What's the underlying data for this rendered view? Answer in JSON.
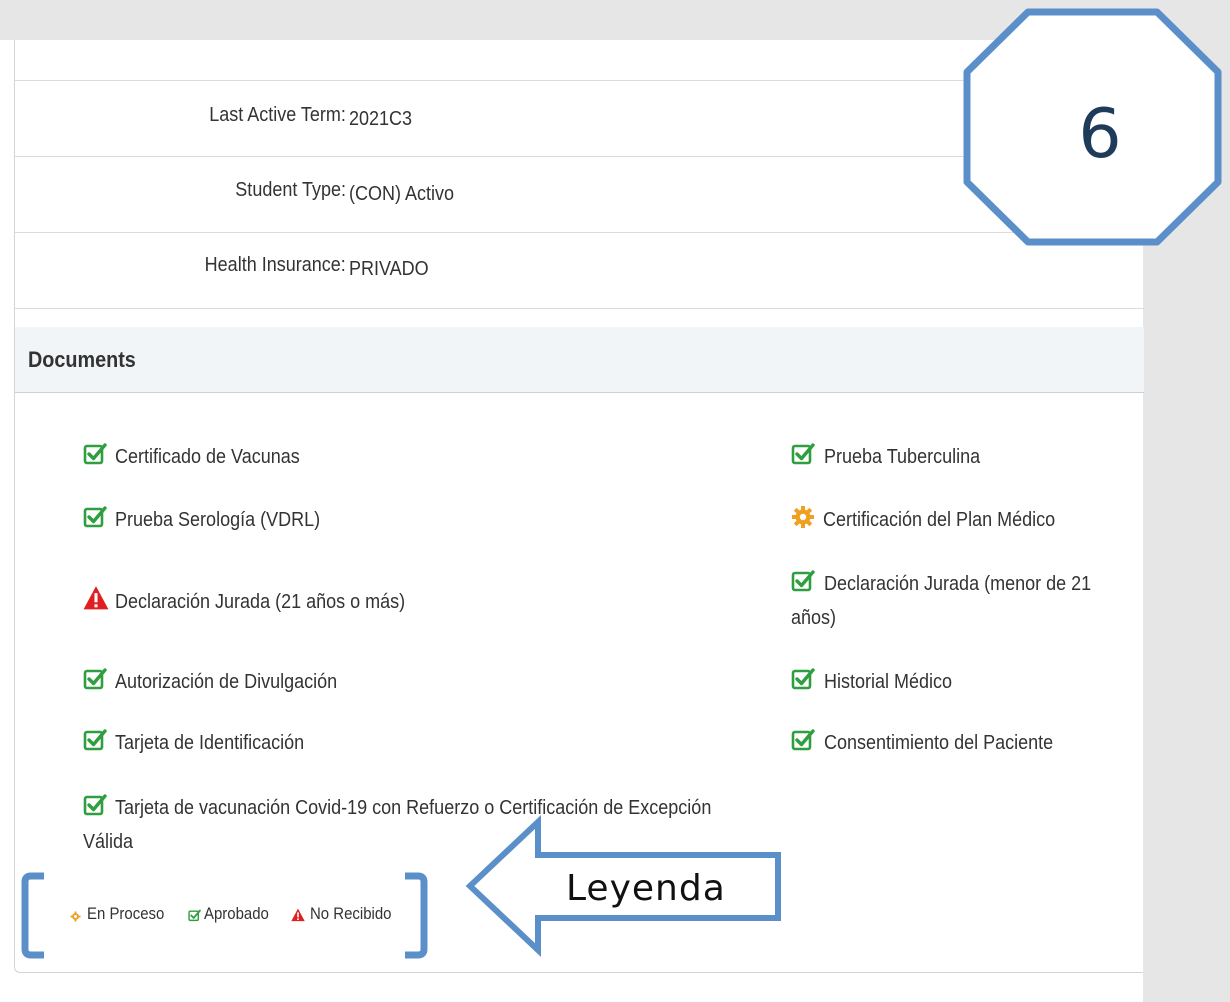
{
  "profile": {
    "rows": [
      {
        "label": "Last Active Term:",
        "value": "2021C3"
      },
      {
        "label": "Student Type:",
        "value": "(CON) Activo"
      },
      {
        "label": "Health Insurance:",
        "value": "PRIVADO"
      }
    ]
  },
  "documents": {
    "title": "Documents",
    "left": [
      {
        "status": "approved",
        "label": "Certificado de Vacunas"
      },
      {
        "status": "approved",
        "label": "Prueba Serología (VDRL)"
      },
      {
        "status": "not-received",
        "label": "Declaración Jurada (21 años o más)"
      },
      {
        "status": "approved",
        "label": "Autorización de Divulgación"
      },
      {
        "status": "approved",
        "label": "Tarjeta de Identificación"
      },
      {
        "status": "approved",
        "label": "Tarjeta de vacunación Covid-19 con Refuerzo o Certificación de Excepción",
        "label2": "Válida"
      }
    ],
    "right": [
      {
        "status": "approved",
        "label": "Prueba Tuberculina"
      },
      {
        "status": "in-process",
        "label": "Certificación del Plan Médico"
      },
      {
        "status": "approved",
        "label": "Declaración Jurada (menor de 21",
        "label2": "años)"
      },
      {
        "status": "approved",
        "label": "Historial Médico"
      },
      {
        "status": "approved",
        "label": "Consentimiento del Paciente"
      }
    ]
  },
  "legend": {
    "in_process": "En Proceso",
    "approved": "Aprobado",
    "not_received": "No Recibido"
  },
  "annotations": {
    "step_number": "6",
    "arrow_label": "Leyenda"
  },
  "colors": {
    "approved": "#2e9e3e",
    "in_process": "#f0a020",
    "not_received": "#e02020",
    "annotation_blue": "#5b8fc9"
  }
}
